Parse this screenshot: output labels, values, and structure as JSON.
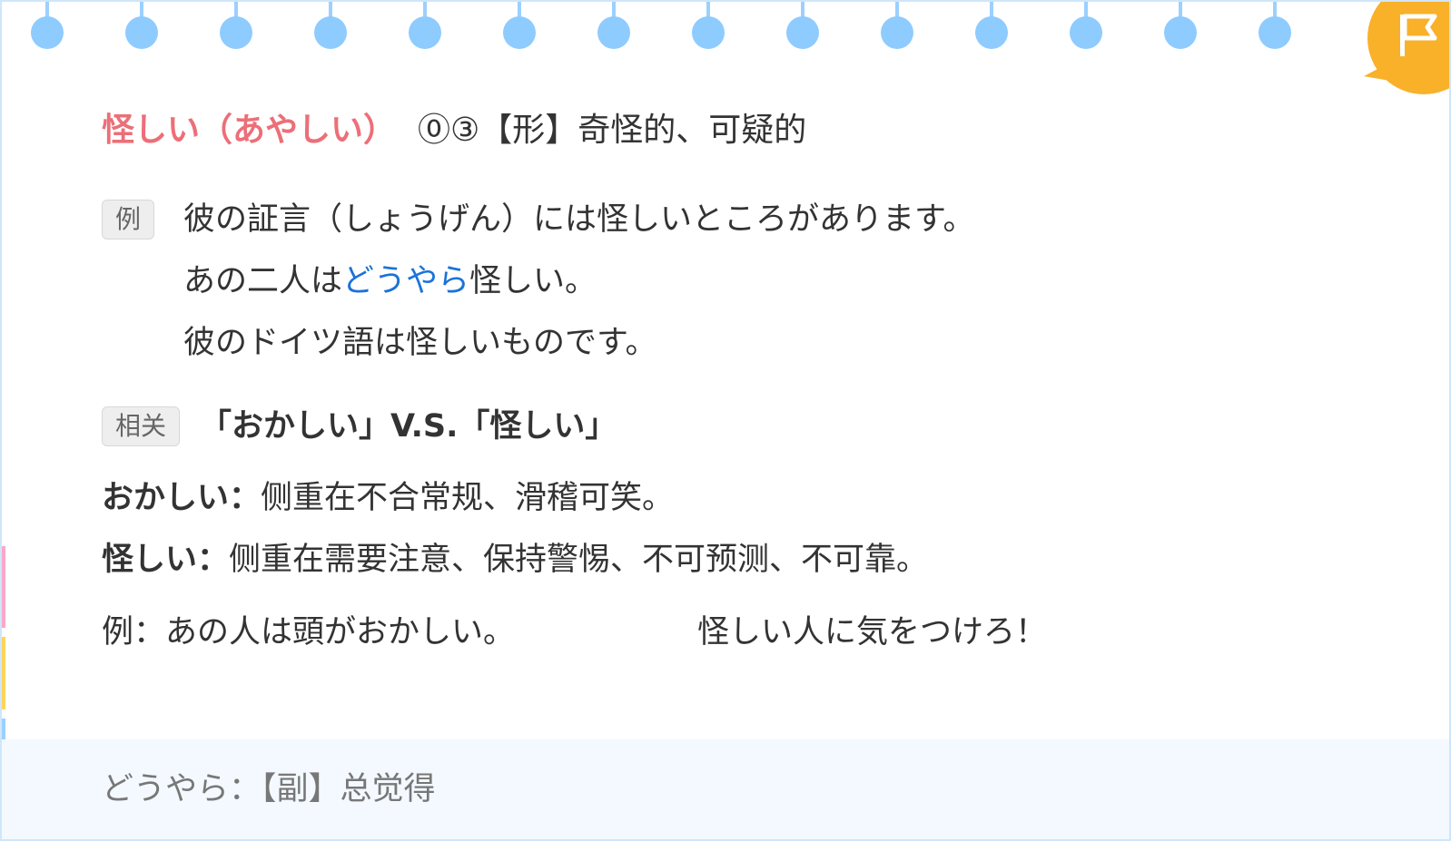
{
  "entry": {
    "headword": "怪しい（あやしい）",
    "meta": "⓪③【形】奇怪的、可疑的"
  },
  "examples": {
    "tag_label": "例",
    "line1": "彼の証言（しょうげん）には怪しいところがあります。",
    "line2_before": "あの二人は",
    "line2_highlight": "どうやら",
    "line2_after": "怪しい。",
    "line3": "彼のドイツ語は怪しいものです。"
  },
  "related": {
    "tag_label": "相关",
    "title": "「おかしい」V.S.「怪しい」",
    "item1_term": "おかしい：",
    "item1_desc": "侧重在不合常规、滑稽可笑。",
    "item2_term": "怪しい：",
    "item2_desc": "侧重在需要注意、保持警惕、不可预测、不可靠。",
    "example_a": "例：あの人は頭がおかしい。",
    "example_b": "怪しい人に気をつけろ！"
  },
  "footer": {
    "note": "どうやら：【副】总觉得"
  },
  "decor": {
    "ring_color": "#8ecbff",
    "accent_red": "#ec6f78",
    "link_blue": "#1a73d9",
    "badge_orange": "#f9b12a",
    "badge_icon": "flag-icon"
  }
}
